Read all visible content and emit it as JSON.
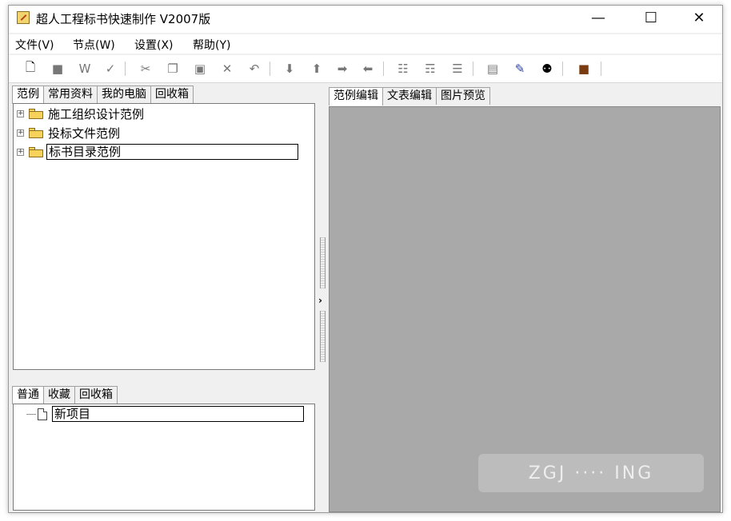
{
  "window": {
    "title": "超人工程标书快速制作 V2007版",
    "controls": {
      "minimize": "—",
      "maximize": "☐",
      "close": "✕"
    }
  },
  "menu": [
    "文件(V)",
    "节点(W)",
    "设置(X)",
    "帮助(Y)"
  ],
  "toolbar": {
    "icons": [
      "new-file-icon",
      "save-icon",
      "edit-icon",
      "spell-icon",
      "cut-icon",
      "copy-icon",
      "paste-icon",
      "delete-icon",
      "undo-icon",
      "move-up-icon",
      "move-top-icon",
      "move-right-icon",
      "move-left-icon",
      "node-add-icon",
      "node-child-icon",
      "node-merge-icon",
      "properties-icon",
      "edit-note-icon",
      "find-icon",
      "exit-icon"
    ]
  },
  "left_tabs": [
    {
      "label": "范例",
      "active": true
    },
    {
      "label": "常用资料",
      "active": false
    },
    {
      "label": "我的电脑",
      "active": false
    },
    {
      "label": "回收箱",
      "active": false
    }
  ],
  "tree": [
    {
      "label": "施工组织设计范例",
      "selected": false
    },
    {
      "label": "投标文件范例",
      "selected": false
    },
    {
      "label": "标书目录范例",
      "selected": true
    }
  ],
  "bottom_tabs": [
    {
      "label": "普通",
      "active": true
    },
    {
      "label": "收藏",
      "active": false
    },
    {
      "label": "回收箱",
      "active": false
    }
  ],
  "project_items": [
    {
      "label": "新项目",
      "selected": true
    }
  ],
  "right_tabs": [
    {
      "label": "范例编辑",
      "active": true
    },
    {
      "label": "文表编辑",
      "active": false
    },
    {
      "label": "图片预览",
      "active": false
    }
  ],
  "watermark_text": "ZGJ ···· ING"
}
